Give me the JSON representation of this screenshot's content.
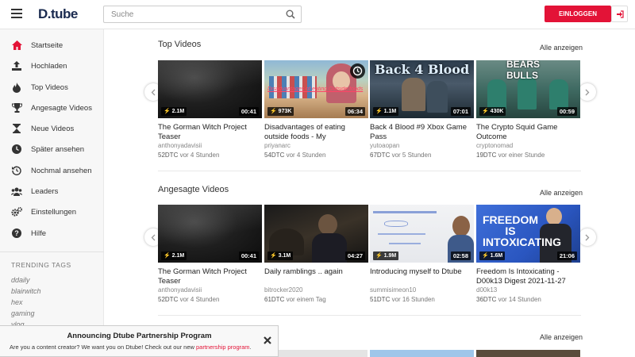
{
  "header": {
    "logo": "D.tube",
    "search_placeholder": "Suche",
    "login_label": "EINLOGGEN"
  },
  "sidebar": {
    "items": [
      {
        "label": "Startseite",
        "icon": "home-icon"
      },
      {
        "label": "Hochladen",
        "icon": "upload-icon"
      },
      {
        "label": "Top Videos",
        "icon": "fire-icon"
      },
      {
        "label": "Angesagte Videos",
        "icon": "trophy-icon"
      },
      {
        "label": "Neue Videos",
        "icon": "hourglass-icon"
      },
      {
        "label": "Später ansehen",
        "icon": "clock-icon"
      },
      {
        "label": "Nochmal ansehen",
        "icon": "history-icon"
      },
      {
        "label": "Leaders",
        "icon": "users-icon"
      },
      {
        "label": "Einstellungen",
        "icon": "gears-icon"
      },
      {
        "label": "Hilfe",
        "icon": "help-icon"
      }
    ],
    "trending_heading": "TRENDING TAGS",
    "tags": [
      "ddaily",
      "blairwitch",
      "hex",
      "gaming",
      "vlog"
    ]
  },
  "sections": [
    {
      "title": "Top Videos",
      "show_all": "Alle anzeigen",
      "videos": [
        {
          "title": "The Gorman Witch Project Teaser",
          "author": "anthonyadavisii",
          "reward": "52DTC",
          "ago": "vor 4 Stunden",
          "views": "2.1M",
          "duration": "00:41",
          "overlay": ""
        },
        {
          "title": "Disadvantages of eating outside foods - My Experiences",
          "author": "priyanarc",
          "reward": "54DTC",
          "ago": "vor 4 Stunden",
          "views": "973K",
          "duration": "06:34",
          "overlay": "Disadvantages of eating Outside foods"
        },
        {
          "title": "Back 4 Blood #9 Xbox Game Pass",
          "author": "yutoaopan",
          "reward": "67DTC",
          "ago": "vor 5 Stunden",
          "views": "1.1M",
          "duration": "07:01",
          "overlay": "Back 4 Blood"
        },
        {
          "title": "The Crypto Squid Game Outcome",
          "author": "cryptonomad",
          "reward": "19DTC",
          "ago": "vor einer Stunde",
          "views": "430K",
          "duration": "00:59",
          "overlay": "BEARS BULLS"
        }
      ]
    },
    {
      "title": "Angesagte Videos",
      "show_all": "Alle anzeigen",
      "videos": [
        {
          "title": "The Gorman Witch Project Teaser",
          "author": "anthonyadavisii",
          "reward": "52DTC",
          "ago": "vor 4 Stunden",
          "views": "2.1M",
          "duration": "00:41",
          "overlay": ""
        },
        {
          "title": "Daily ramblings .. again",
          "author": "bitrocker2020",
          "reward": "61DTC",
          "ago": "vor einem Tag",
          "views": "3.1M",
          "duration": "04:27",
          "overlay": ""
        },
        {
          "title": "Introducing myself to Dtube",
          "author": "summisimeon10",
          "reward": "51DTC",
          "ago": "vor 16 Stunden",
          "views": "1.9M",
          "duration": "02:58",
          "overlay": ""
        },
        {
          "title": "Freedom Is Intoxicating - D00k13 Digest 2021-11-27",
          "author": "d00k13",
          "reward": "36DTC",
          "ago": "vor 14 Stunden",
          "views": "1.6M",
          "duration": "21:06",
          "overlay": "FREEDOM IS INTOXICATING"
        }
      ]
    },
    {
      "title": "",
      "show_all": "Alle anzeigen"
    }
  ],
  "banner": {
    "title": "Announcing Dtube Partnership Program",
    "text": "Are you a content creator? We want you on Dtube! Check out our new ",
    "link": "partnership program",
    "end": "."
  },
  "colors": {
    "accent": "#e31337",
    "logo": "#1a2a4f",
    "sidebar_bg": "#f7f7f7"
  }
}
